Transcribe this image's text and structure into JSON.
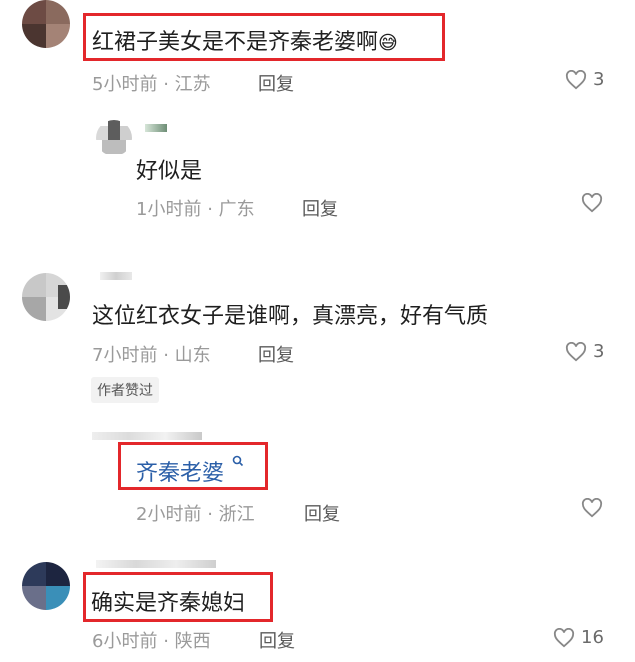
{
  "comments": [
    {
      "text": "红裙子美女是不是齐秦老婆啊",
      "emoji": "😅",
      "time": "5小时前",
      "location": "江苏",
      "reply_label": "回复",
      "likes": "3",
      "reply": {
        "text": "好似是",
        "time": "1小时前",
        "location": "广东",
        "reply_label": "回复"
      }
    },
    {
      "text": "这位红衣女子是谁啊，真漂亮，好有气质",
      "time": "7小时前",
      "location": "山东",
      "reply_label": "回复",
      "likes": "3",
      "badge": "作者赞过",
      "reply": {
        "text": "齐秦老婆",
        "search_icon": "search-icon",
        "time": "2小时前",
        "location": "浙江",
        "reply_label": "回复"
      }
    },
    {
      "text": "确实是齐秦媳妇",
      "time": "6小时前",
      "location": "陕西",
      "reply_label": "回复",
      "likes": "16"
    }
  ],
  "separator": "·",
  "colors": {
    "highlight_box": "#e3272b",
    "link": "#2b5fa8",
    "meta": "#9a9a9a"
  }
}
